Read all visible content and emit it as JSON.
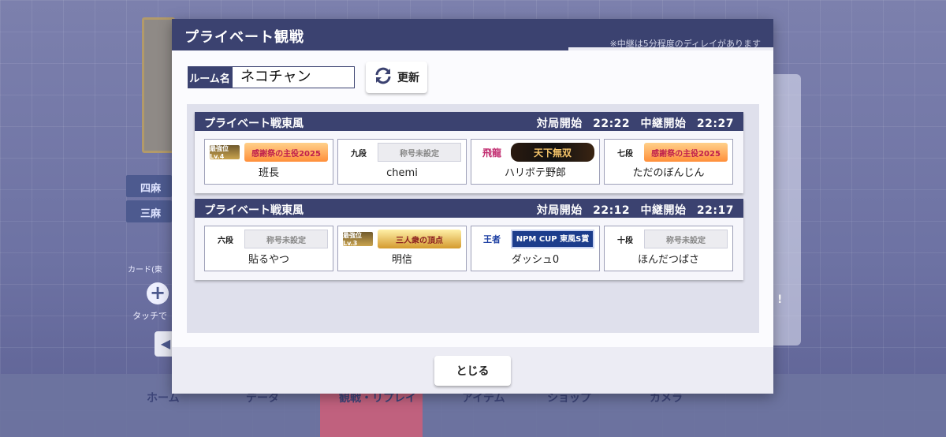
{
  "background": {
    "mode_tabs": [
      "四麻",
      "三麻"
    ],
    "card_label": "カード(東",
    "touch_text": "タッチで",
    "nav_items": [
      "ホーム",
      "データ",
      "観戦・リプレイ",
      "アイテム",
      "ショップ",
      "カメラ"
    ]
  },
  "modal": {
    "title": "プライベート観戦",
    "note": "※中継は5分程度のディレイがあります",
    "room_label": "ルーム名",
    "room_value": "ネコチャン",
    "refresh_label": "更新",
    "close_label": "とじる"
  },
  "matches": [
    {
      "type": "プライベート戦東風",
      "start_label": "対局開始",
      "start_time": "22:22",
      "relay_label": "中継開始",
      "relay_time": "22:27",
      "players": [
        {
          "rank": "最強位Lv.4",
          "title": "感謝祭の主役2025",
          "name": "班長"
        },
        {
          "rank": "九段",
          "title": "称号未設定",
          "name": "chemi"
        },
        {
          "rank": "飛龍",
          "title": "天下無双",
          "name": "ハリボテ野郎"
        },
        {
          "rank": "七段",
          "title": "感謝祭の主役2025",
          "name": "ただのぼんじん"
        }
      ]
    },
    {
      "type": "プライベート戦東風",
      "start_label": "対局開始",
      "start_time": "22:12",
      "relay_label": "中継開始",
      "relay_time": "22:17",
      "players": [
        {
          "rank": "六段",
          "title": "称号未設定",
          "name": "貼るやつ"
        },
        {
          "rank": "最強位Lv.3",
          "title": "三人衆の頂点",
          "name": "明信"
        },
        {
          "rank": "王者",
          "title": "NPM CUP 東風S賞",
          "name": "ダッシュ0"
        },
        {
          "rank": "十段",
          "title": "称号未設定",
          "name": "ほんだつばさ"
        }
      ]
    }
  ],
  "colors": {
    "header": "#3b4270",
    "modal_bg": "#ececf4",
    "list_bg": "#dfe0ec"
  },
  "icons": {
    "refresh": "refresh-icon"
  }
}
